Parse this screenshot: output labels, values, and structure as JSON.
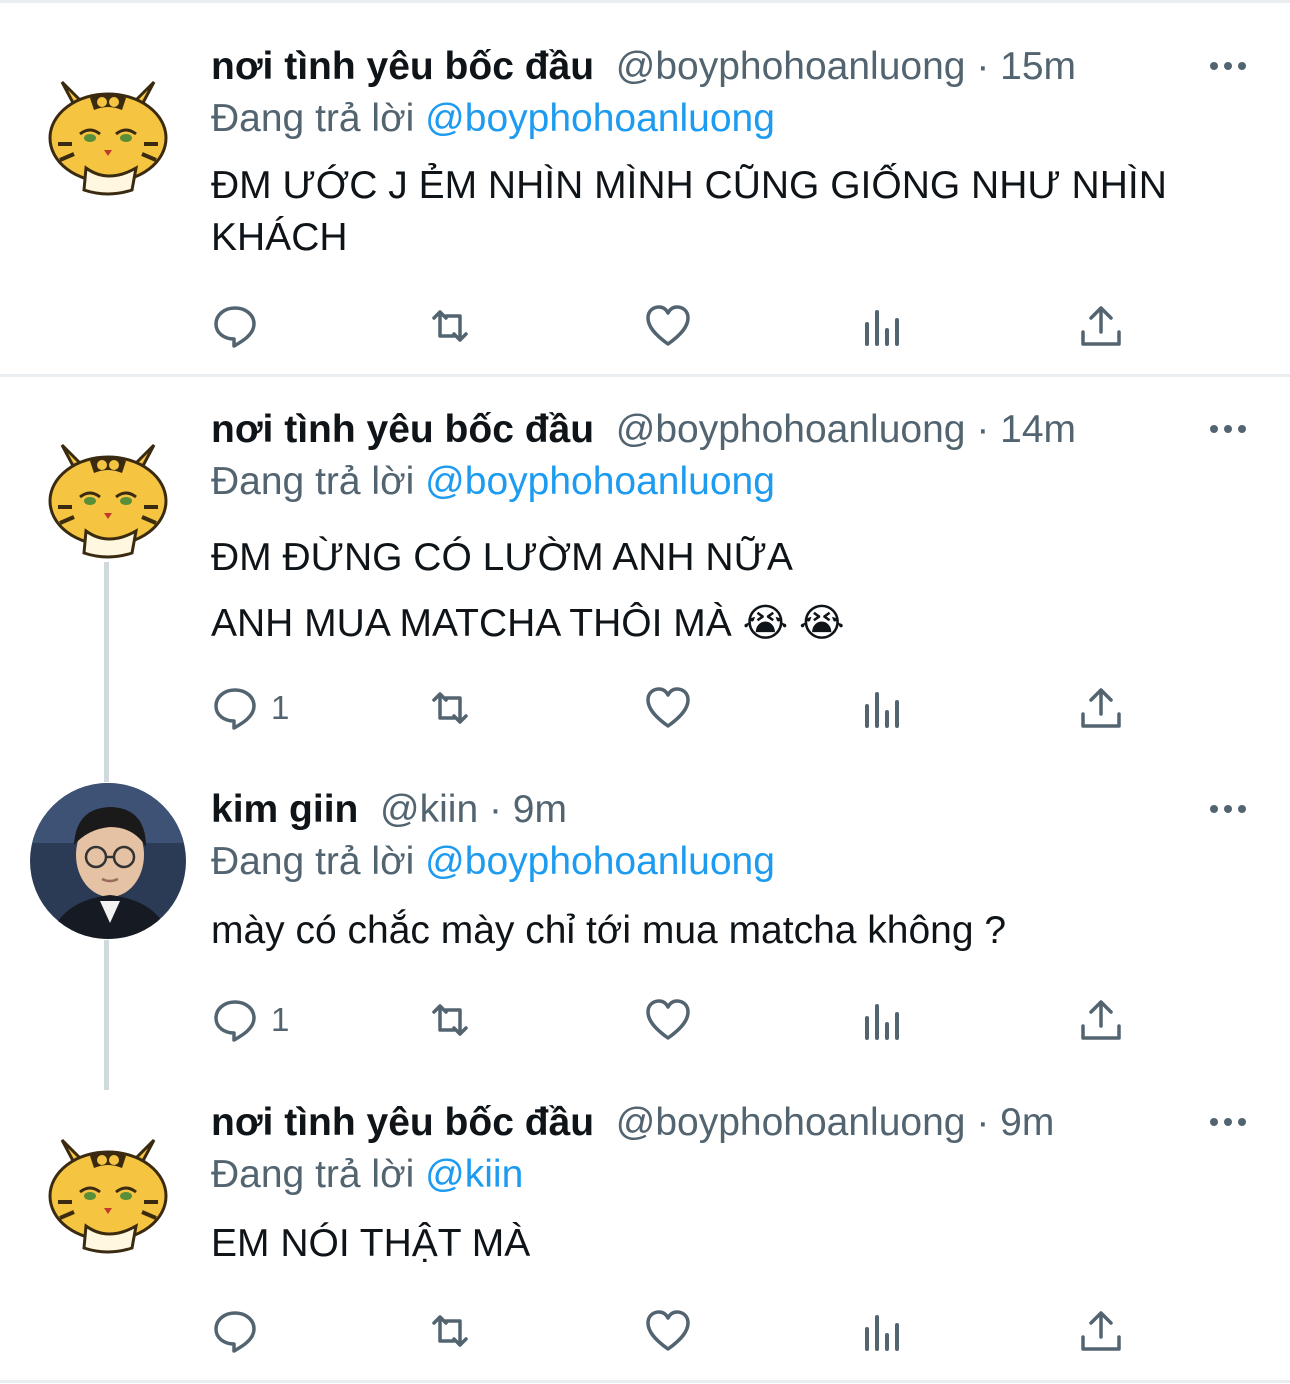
{
  "tweets": [
    {
      "name": "nơi tình yêu bốc đầu",
      "handle": "@boyphohoanluong",
      "time": "· 15m",
      "replying_prefix": "Đang trả lời",
      "replying_to": "@boyphohoanluong",
      "lines": [
        "ĐM ƯỚC J ẺM NHÌN MÌNH CŨNG GIỐNG NHƯ NHÌN",
        "KHÁCH"
      ],
      "reply_count": "",
      "avatar": "tiger-avatar"
    },
    {
      "name": "nơi tình yêu bốc đầu",
      "handle": "@boyphohoanluong",
      "time": "· 14m",
      "replying_prefix": "Đang trả lời",
      "replying_to": "@boyphohoanluong",
      "lines": [
        "ĐM ĐỪNG CÓ LƯỜM ANH NỮA",
        "ANH MUA MATCHA THÔI MÀ"
      ],
      "emoji": "😭 😭",
      "reply_count": "1",
      "avatar": "tiger-avatar"
    },
    {
      "name": "kim giin",
      "handle": "@kiin",
      "time": "· 9m",
      "replying_prefix": "Đang trả lời",
      "replying_to": "@boyphohoanluong",
      "lines": [
        "mày có chắc mày chỉ tới mua matcha không ?"
      ],
      "reply_count": "1",
      "avatar": "photo-avatar"
    },
    {
      "name": "nơi tình yêu bốc đầu",
      "handle": "@boyphohoanluong",
      "time": "· 9m",
      "replying_prefix": "Đang trả lời",
      "replying_to": "@kiin",
      "lines": [
        "EM NÓI THẬT MÀ"
      ],
      "reply_count": "",
      "avatar": "tiger-avatar"
    }
  ],
  "icons": {
    "reply": "comment-bubble-icon",
    "retweet": "retweet-icon",
    "like": "heart-icon",
    "views": "analytics-icon",
    "share": "share-upload-icon",
    "more": "more-dots-icon"
  },
  "colors": {
    "name": "#0f1419",
    "meta": "#536471",
    "mention": "#1d9bf0",
    "icon": "#536471",
    "divider": "#ebeef0",
    "thread_line": "#cfd9de",
    "tiger_fur": "#f5c542"
  }
}
